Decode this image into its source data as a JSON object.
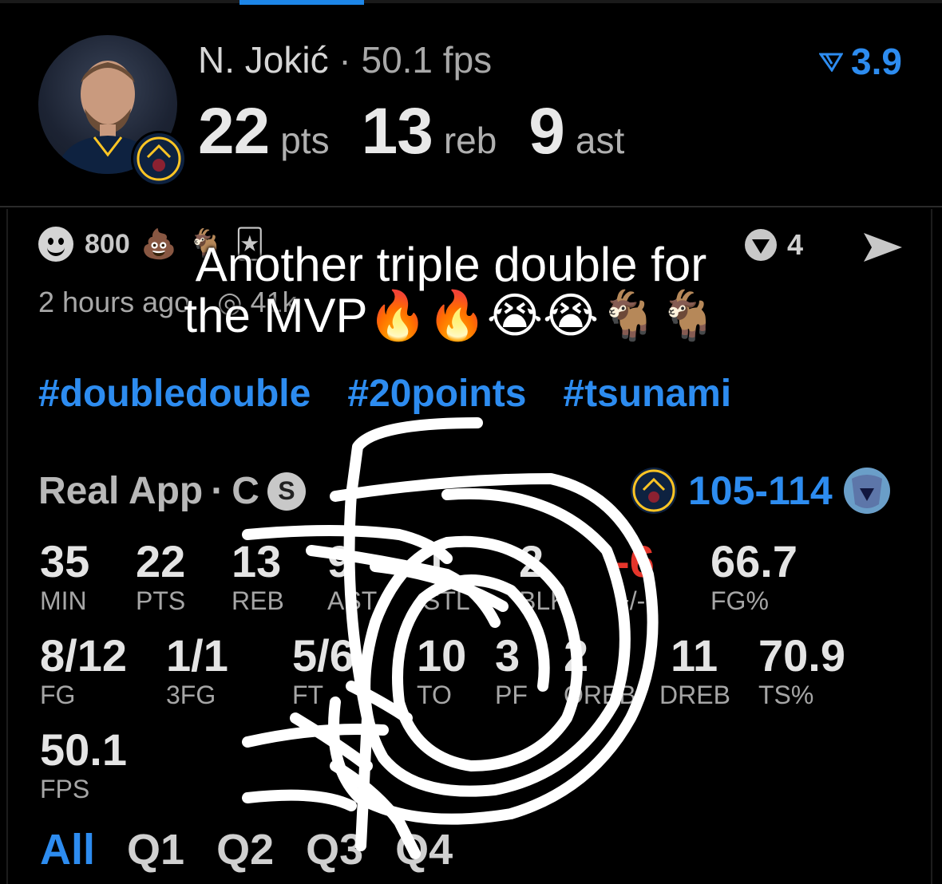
{
  "player": {
    "name": "N. Jokić",
    "separator": "·",
    "fps_summary": "50.1 fps",
    "rating": "3.9",
    "points": "22",
    "points_unit": "pts",
    "rebounds": "13",
    "rebounds_unit": "reb",
    "assists": "9",
    "assists_unit": "ast"
  },
  "post": {
    "reaction_count": "800",
    "time_ago": "2 hours ago",
    "views": "41k",
    "comment_count": "4",
    "caption_line1": "Another triple double for",
    "caption_line2": "the MVP🔥🔥😭😭🐐🐐",
    "hashtags": [
      "#doubledouble",
      "#20points",
      "#tsunami"
    ]
  },
  "game": {
    "source": "Real App",
    "position": "C",
    "badge": "S",
    "score": "105-114"
  },
  "stats_row1": [
    {
      "value": "35",
      "label": "MIN"
    },
    {
      "value": "22",
      "label": "PTS"
    },
    {
      "value": "13",
      "label": "REB"
    },
    {
      "value": "9",
      "label": "AST"
    },
    {
      "value": "1",
      "label": "STL"
    },
    {
      "value": "2",
      "label": "BLK"
    },
    {
      "value": "-6",
      "label": "+/-"
    },
    {
      "value": "66.7",
      "label": "FG%"
    }
  ],
  "stats_row2": [
    {
      "value": "8/12",
      "label": "FG"
    },
    {
      "value": "1/1",
      "label": "3FG"
    },
    {
      "value": "5/6",
      "label": "FT"
    },
    {
      "value": "10",
      "label": "TO"
    },
    {
      "value": "3",
      "label": "PF"
    },
    {
      "value": "2",
      "label": "OREB"
    },
    {
      "value": "11",
      "label": "DREB"
    },
    {
      "value": "70.9",
      "label": "TS%"
    }
  ],
  "stats_row3": [
    {
      "value": "50.1",
      "label": "FPS"
    }
  ],
  "periods": [
    "All",
    "Q1",
    "Q2",
    "Q3",
    "Q4"
  ],
  "colors": {
    "accent": "#2d8cf0",
    "negative": "#e5352b",
    "background": "#000000"
  }
}
